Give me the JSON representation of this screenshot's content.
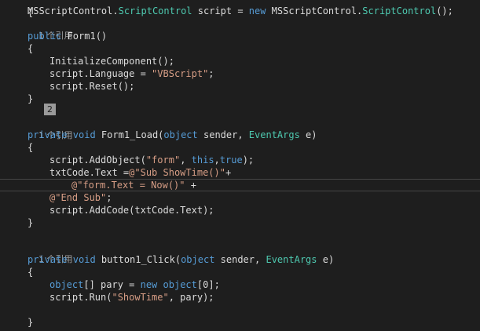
{
  "editor": {
    "top_brace": "{",
    "field_decl": {
      "t1": "MSScriptControl.",
      "t2": "ScriptControl",
      "t3": " script = ",
      "t4": "new",
      "t5": " MSScriptControl.",
      "t6": "ScriptControl",
      "t7": "();"
    },
    "ref1": "1 个引用",
    "ctor": {
      "kw": "public",
      "name": " Form1()",
      "open": "{",
      "init": "InitializeComponent();",
      "lang_a": "script.Language = ",
      "lang_b": "\"VBScript\"",
      "lang_c": ";",
      "reset": "script.Reset();",
      "close": "}"
    },
    "badge": "2",
    "ref2": "1 个引用",
    "load": {
      "kw1": "private",
      "kw2": " void",
      "name": " Form1_Load(",
      "kw3": "object",
      "p1": " sender, ",
      "ty": "EventArgs",
      "p2": " e)",
      "open": "{",
      "addobj_a": "script.AddObject(",
      "addobj_b": "\"form\"",
      "addobj_c": ", ",
      "addobj_d": "this",
      "addobj_e": ",",
      "addobj_f": "true",
      "addobj_g": ");",
      "txt_a": "txtCode.Text =",
      "txt_b": "@\"Sub ShowTime()\"",
      "txt_c": "+",
      "form_b": "@\"form.Text = Now()\"",
      "form_c": " +",
      "end_b": "@\"End Sub\"",
      "end_c": ";",
      "addcode": "script.AddCode(txtCode.Text);",
      "close": "}"
    },
    "ref3": "1 个引用",
    "click": {
      "kw1": "private",
      "kw2": " void",
      "name": " button1_Click(",
      "kw3": "object",
      "p1": " sender, ",
      "ty": "EventArgs",
      "p2": " e)",
      "open": "{",
      "arr_a": "object",
      "arr_b": "[] pary = ",
      "arr_c": "new",
      "arr_d": " ",
      "arr_e": "object",
      "arr_f": "[0];",
      "run_a": "script.Run(",
      "run_b": "\"ShowTime\"",
      "run_c": ", pary);",
      "close": "}"
    }
  }
}
